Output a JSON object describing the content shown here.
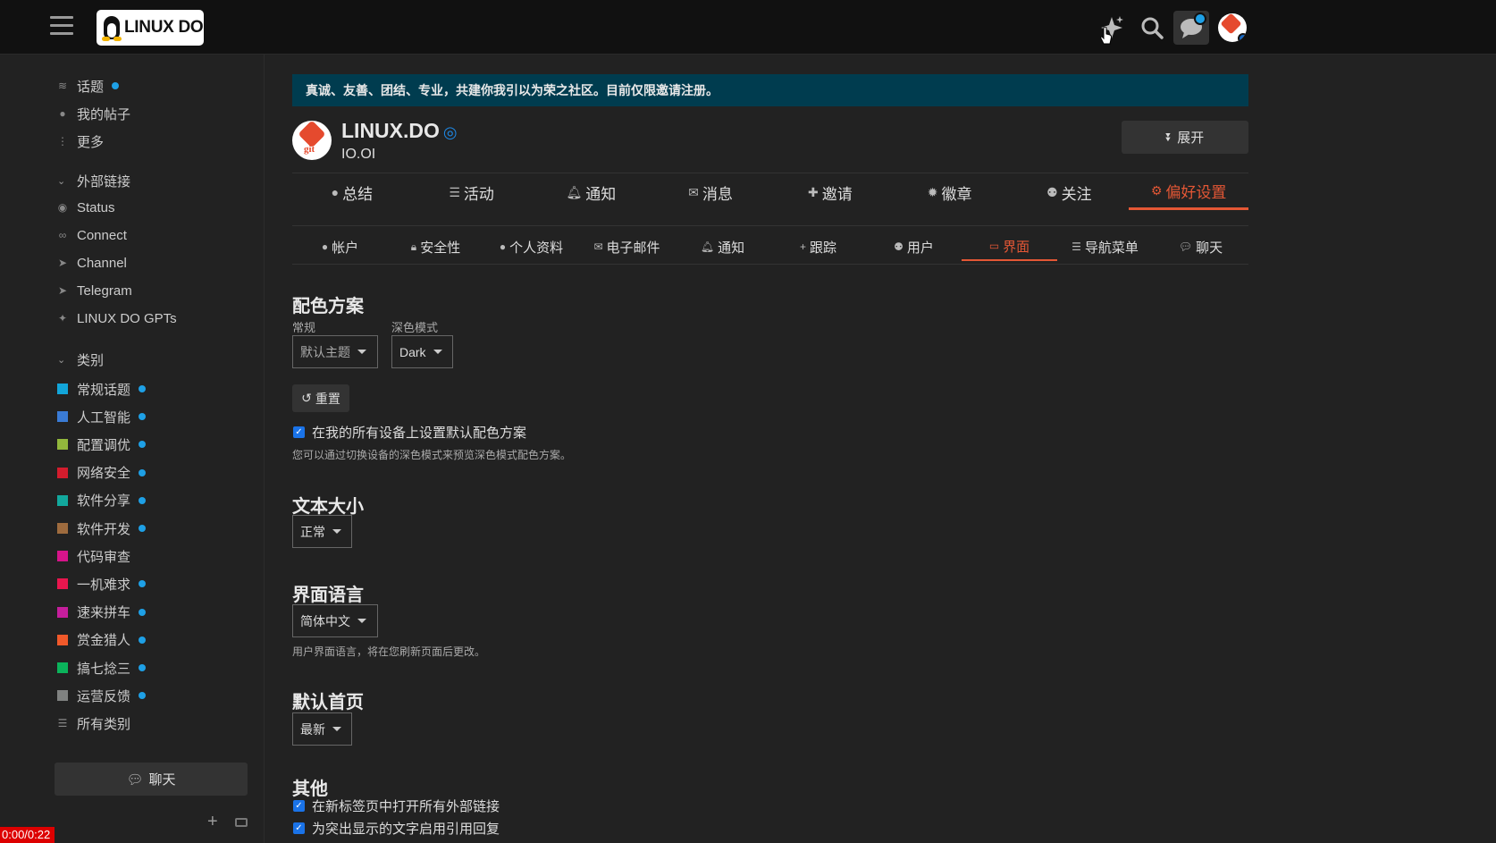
{
  "header": {
    "logo_text": "LINUX DO",
    "icons": [
      "hamburger-icon",
      "ai-sparkle-icon",
      "search-icon",
      "chat-icon",
      "user-avatar"
    ]
  },
  "sidebar": {
    "top_items": [
      {
        "label": "话题",
        "icon": "layers-icon",
        "dot": true
      },
      {
        "label": "我的帖子",
        "icon": "user-icon",
        "dot": false
      },
      {
        "label": "更多",
        "icon": "more-vertical-icon",
        "dot": false
      }
    ],
    "external_links_header": "外部链接",
    "external_links": [
      {
        "label": "Status",
        "icon": "eye-icon"
      },
      {
        "label": "Connect",
        "icon": "link-icon"
      },
      {
        "label": "Channel",
        "icon": "paper-plane-icon"
      },
      {
        "label": "Telegram",
        "icon": "paper-plane-icon"
      },
      {
        "label": "LINUX DO GPTs",
        "icon": "sparkle-icon"
      }
    ],
    "categories_header": "类别",
    "categories": [
      {
        "label": "常规话题",
        "color": "#12a5d9",
        "dot": true
      },
      {
        "label": "人工智能",
        "color": "#3a7bd5",
        "dot": true
      },
      {
        "label": "配置调优",
        "color": "#92b83c",
        "dot": true
      },
      {
        "label": "网络安全",
        "color": "#d31c2d",
        "dot": true
      },
      {
        "label": "软件分享",
        "color": "#12a89d",
        "dot": true
      },
      {
        "label": "软件开发",
        "color": "#9e6b3e",
        "dot": true
      },
      {
        "label": "代码审查",
        "color": "#d6148a",
        "dot": false
      },
      {
        "label": "一机难求",
        "color": "#e9164e",
        "dot": true
      },
      {
        "label": "速来拼车",
        "color": "#c51e9c",
        "dot": true
      },
      {
        "label": "赏金猎人",
        "color": "#f1592a",
        "dot": true
      },
      {
        "label": "搞七捻三",
        "color": "#0bb35b",
        "dot": true
      },
      {
        "label": "运营反馈",
        "color": "#808281",
        "dot": true
      }
    ],
    "all_categories": "所有类别",
    "chat_button": "聊天",
    "plus_icon": "plus-icon",
    "keyboard_icon": "keyboard-icon"
  },
  "timecode": "0:00/0:22",
  "banner": "真诚、友善、团结、专业，共建你我引以为荣之社区。目前仅限邀请注册。",
  "user": {
    "name": "LINUX.DO",
    "handle": "IO.OI",
    "expand_label": "展开"
  },
  "tabs": [
    {
      "label": "总结",
      "icon": "user-icon",
      "active": false
    },
    {
      "label": "活动",
      "icon": "list-icon",
      "active": false
    },
    {
      "label": "通知",
      "icon": "bell-icon",
      "active": false
    },
    {
      "label": "消息",
      "icon": "envelope-icon",
      "active": false
    },
    {
      "label": "邀请",
      "icon": "user-plus-icon",
      "active": false
    },
    {
      "label": "徽章",
      "icon": "badge-icon",
      "active": false
    },
    {
      "label": "关注",
      "icon": "users-icon",
      "active": false
    },
    {
      "label": "偏好设置",
      "icon": "gear-icon",
      "active": true
    }
  ],
  "subtabs": [
    {
      "label": "帐户",
      "icon": "user-icon",
      "active": false
    },
    {
      "label": "安全性",
      "icon": "lock-icon",
      "active": false
    },
    {
      "label": "个人资料",
      "icon": "user-icon",
      "active": false
    },
    {
      "label": "电子邮件",
      "icon": "envelope-icon",
      "active": false
    },
    {
      "label": "通知",
      "icon": "bell-icon",
      "active": false
    },
    {
      "label": "跟踪",
      "icon": "plus-icon",
      "active": false
    },
    {
      "label": "用户",
      "icon": "users-icon",
      "active": false
    },
    {
      "label": "界面",
      "icon": "desktop-icon",
      "active": true
    },
    {
      "label": "导航菜单",
      "icon": "bars-icon",
      "active": false
    },
    {
      "label": "聊天",
      "icon": "comment-icon",
      "active": false
    }
  ],
  "color_scheme": {
    "title": "配色方案",
    "regular_label": "常规",
    "regular_value": "默认主题",
    "dark_label": "深色模式",
    "dark_value": "Dark",
    "reset_label": "重置",
    "default_on_all_devices": "在我的所有设备上设置默认配色方案",
    "hint": "您可以通过切换设备的深色模式来预览深色模式配色方案。"
  },
  "text_size": {
    "title": "文本大小",
    "value": "正常"
  },
  "ui_language": {
    "title": "界面语言",
    "value": "简体中文",
    "hint": "用户界面语言，将在您刷新页面后更改。"
  },
  "default_home": {
    "title": "默认首页",
    "value": "最新"
  },
  "other": {
    "title": "其他",
    "options": [
      {
        "label": "在新标签页中打开所有外部链接",
        "checked": true
      },
      {
        "label": "为突出显示的文字启用引用回复",
        "checked": true
      }
    ]
  }
}
